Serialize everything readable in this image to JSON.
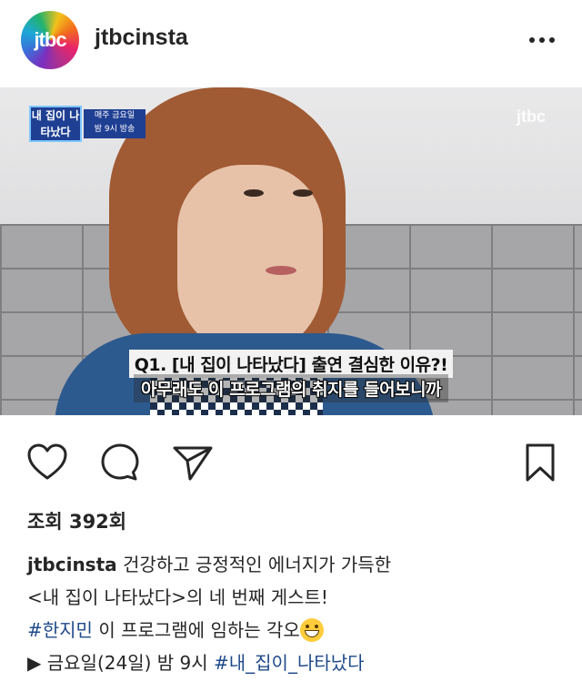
{
  "header": {
    "avatar_text": "jtbc",
    "username": "jtbcinsta"
  },
  "media": {
    "show_logo": "내 집이 나타났다",
    "show_time_line1": "매주 금요일",
    "show_time_line2": "밤 9시 방송",
    "watermark": "jtbc",
    "subtitle_question": "Q1. [내 집이 나타났다] 출연 결심한 이유?!",
    "subtitle_answer": "아무래도 이 프로그램의 취지를 들어보니까"
  },
  "stats": {
    "views": "조회 392회"
  },
  "caption": {
    "username": "jtbcinsta",
    "line1_text": "건강하고 긍정적인 에너지가 가득한",
    "line2_text": "<내 집이 나타났다>의 네 번째 게스트!",
    "line3_hashtag": "#한지민",
    "line3_text": "이 프로그램에 임하는 각오",
    "line4_prefix": "▶ 금요일(24일) 밤 9시",
    "line4_hashtag": "#내_집이_나타났다"
  },
  "colors": {
    "hashtag": "#1f4a8a",
    "text": "#262626"
  },
  "icons": [
    "heart-icon",
    "comment-icon",
    "share-icon",
    "bookmark-icon",
    "more-icon"
  ]
}
